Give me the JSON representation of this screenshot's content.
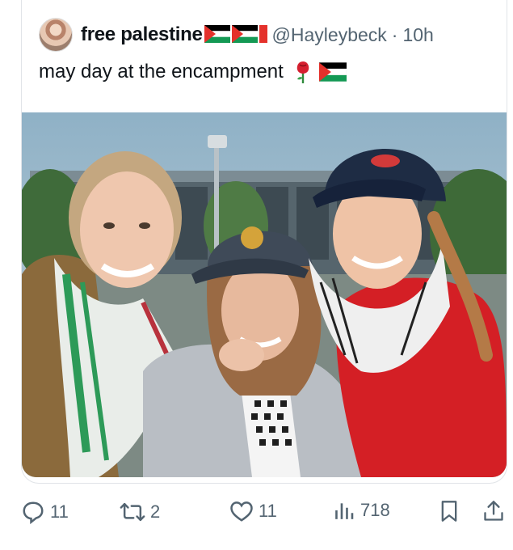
{
  "tweet": {
    "display_name": "free palestine",
    "handle": "@Hayleybeck",
    "separator": "·",
    "time_ago": "10h",
    "text": "may day at the encampment",
    "emoji": [
      "rose",
      "palestine-flag"
    ]
  },
  "actions": {
    "replies": "11",
    "retweets": "2",
    "likes": "11",
    "views": "718"
  },
  "colors": {
    "flag_red": "#e4312b",
    "flag_green": "#149954",
    "flag_black": "#000000",
    "text_muted": "#536471"
  }
}
